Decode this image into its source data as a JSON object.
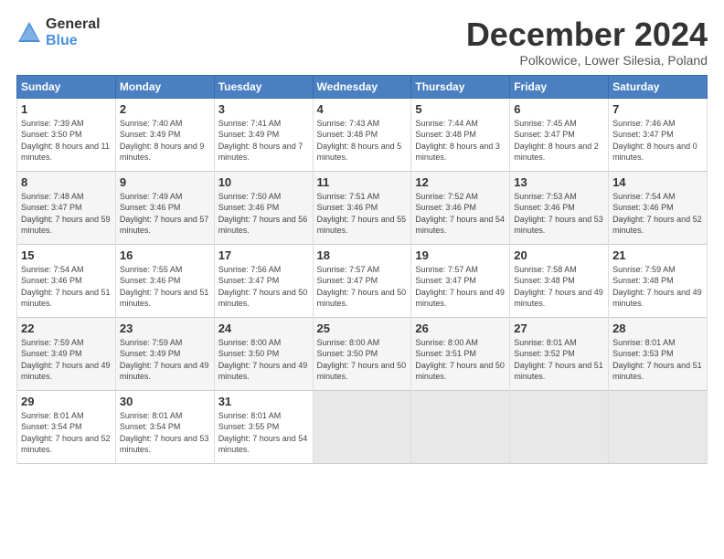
{
  "header": {
    "logo_general": "General",
    "logo_blue": "Blue",
    "month_title": "December 2024",
    "subtitle": "Polkowice, Lower Silesia, Poland"
  },
  "weekdays": [
    "Sunday",
    "Monday",
    "Tuesday",
    "Wednesday",
    "Thursday",
    "Friday",
    "Saturday"
  ],
  "weeks": [
    [
      {
        "day": 1,
        "sunrise": "Sunrise: 7:39 AM",
        "sunset": "Sunset: 3:50 PM",
        "daylight": "Daylight: 8 hours and 11 minutes."
      },
      {
        "day": 2,
        "sunrise": "Sunrise: 7:40 AM",
        "sunset": "Sunset: 3:49 PM",
        "daylight": "Daylight: 8 hours and 9 minutes."
      },
      {
        "day": 3,
        "sunrise": "Sunrise: 7:41 AM",
        "sunset": "Sunset: 3:49 PM",
        "daylight": "Daylight: 8 hours and 7 minutes."
      },
      {
        "day": 4,
        "sunrise": "Sunrise: 7:43 AM",
        "sunset": "Sunset: 3:48 PM",
        "daylight": "Daylight: 8 hours and 5 minutes."
      },
      {
        "day": 5,
        "sunrise": "Sunrise: 7:44 AM",
        "sunset": "Sunset: 3:48 PM",
        "daylight": "Daylight: 8 hours and 3 minutes."
      },
      {
        "day": 6,
        "sunrise": "Sunrise: 7:45 AM",
        "sunset": "Sunset: 3:47 PM",
        "daylight": "Daylight: 8 hours and 2 minutes."
      },
      {
        "day": 7,
        "sunrise": "Sunrise: 7:46 AM",
        "sunset": "Sunset: 3:47 PM",
        "daylight": "Daylight: 8 hours and 0 minutes."
      }
    ],
    [
      {
        "day": 8,
        "sunrise": "Sunrise: 7:48 AM",
        "sunset": "Sunset: 3:47 PM",
        "daylight": "Daylight: 7 hours and 59 minutes."
      },
      {
        "day": 9,
        "sunrise": "Sunrise: 7:49 AM",
        "sunset": "Sunset: 3:46 PM",
        "daylight": "Daylight: 7 hours and 57 minutes."
      },
      {
        "day": 10,
        "sunrise": "Sunrise: 7:50 AM",
        "sunset": "Sunset: 3:46 PM",
        "daylight": "Daylight: 7 hours and 56 minutes."
      },
      {
        "day": 11,
        "sunrise": "Sunrise: 7:51 AM",
        "sunset": "Sunset: 3:46 PM",
        "daylight": "Daylight: 7 hours and 55 minutes."
      },
      {
        "day": 12,
        "sunrise": "Sunrise: 7:52 AM",
        "sunset": "Sunset: 3:46 PM",
        "daylight": "Daylight: 7 hours and 54 minutes."
      },
      {
        "day": 13,
        "sunrise": "Sunrise: 7:53 AM",
        "sunset": "Sunset: 3:46 PM",
        "daylight": "Daylight: 7 hours and 53 minutes."
      },
      {
        "day": 14,
        "sunrise": "Sunrise: 7:54 AM",
        "sunset": "Sunset: 3:46 PM",
        "daylight": "Daylight: 7 hours and 52 minutes."
      }
    ],
    [
      {
        "day": 15,
        "sunrise": "Sunrise: 7:54 AM",
        "sunset": "Sunset: 3:46 PM",
        "daylight": "Daylight: 7 hours and 51 minutes."
      },
      {
        "day": 16,
        "sunrise": "Sunrise: 7:55 AM",
        "sunset": "Sunset: 3:46 PM",
        "daylight": "Daylight: 7 hours and 51 minutes."
      },
      {
        "day": 17,
        "sunrise": "Sunrise: 7:56 AM",
        "sunset": "Sunset: 3:47 PM",
        "daylight": "Daylight: 7 hours and 50 minutes."
      },
      {
        "day": 18,
        "sunrise": "Sunrise: 7:57 AM",
        "sunset": "Sunset: 3:47 PM",
        "daylight": "Daylight: 7 hours and 50 minutes."
      },
      {
        "day": 19,
        "sunrise": "Sunrise: 7:57 AM",
        "sunset": "Sunset: 3:47 PM",
        "daylight": "Daylight: 7 hours and 49 minutes."
      },
      {
        "day": 20,
        "sunrise": "Sunrise: 7:58 AM",
        "sunset": "Sunset: 3:48 PM",
        "daylight": "Daylight: 7 hours and 49 minutes."
      },
      {
        "day": 21,
        "sunrise": "Sunrise: 7:59 AM",
        "sunset": "Sunset: 3:48 PM",
        "daylight": "Daylight: 7 hours and 49 minutes."
      }
    ],
    [
      {
        "day": 22,
        "sunrise": "Sunrise: 7:59 AM",
        "sunset": "Sunset: 3:49 PM",
        "daylight": "Daylight: 7 hours and 49 minutes."
      },
      {
        "day": 23,
        "sunrise": "Sunrise: 7:59 AM",
        "sunset": "Sunset: 3:49 PM",
        "daylight": "Daylight: 7 hours and 49 minutes."
      },
      {
        "day": 24,
        "sunrise": "Sunrise: 8:00 AM",
        "sunset": "Sunset: 3:50 PM",
        "daylight": "Daylight: 7 hours and 49 minutes."
      },
      {
        "day": 25,
        "sunrise": "Sunrise: 8:00 AM",
        "sunset": "Sunset: 3:50 PM",
        "daylight": "Daylight: 7 hours and 50 minutes."
      },
      {
        "day": 26,
        "sunrise": "Sunrise: 8:00 AM",
        "sunset": "Sunset: 3:51 PM",
        "daylight": "Daylight: 7 hours and 50 minutes."
      },
      {
        "day": 27,
        "sunrise": "Sunrise: 8:01 AM",
        "sunset": "Sunset: 3:52 PM",
        "daylight": "Daylight: 7 hours and 51 minutes."
      },
      {
        "day": 28,
        "sunrise": "Sunrise: 8:01 AM",
        "sunset": "Sunset: 3:53 PM",
        "daylight": "Daylight: 7 hours and 51 minutes."
      }
    ],
    [
      {
        "day": 29,
        "sunrise": "Sunrise: 8:01 AM",
        "sunset": "Sunset: 3:54 PM",
        "daylight": "Daylight: 7 hours and 52 minutes."
      },
      {
        "day": 30,
        "sunrise": "Sunrise: 8:01 AM",
        "sunset": "Sunset: 3:54 PM",
        "daylight": "Daylight: 7 hours and 53 minutes."
      },
      {
        "day": 31,
        "sunrise": "Sunrise: 8:01 AM",
        "sunset": "Sunset: 3:55 PM",
        "daylight": "Daylight: 7 hours and 54 minutes."
      },
      null,
      null,
      null,
      null
    ]
  ]
}
